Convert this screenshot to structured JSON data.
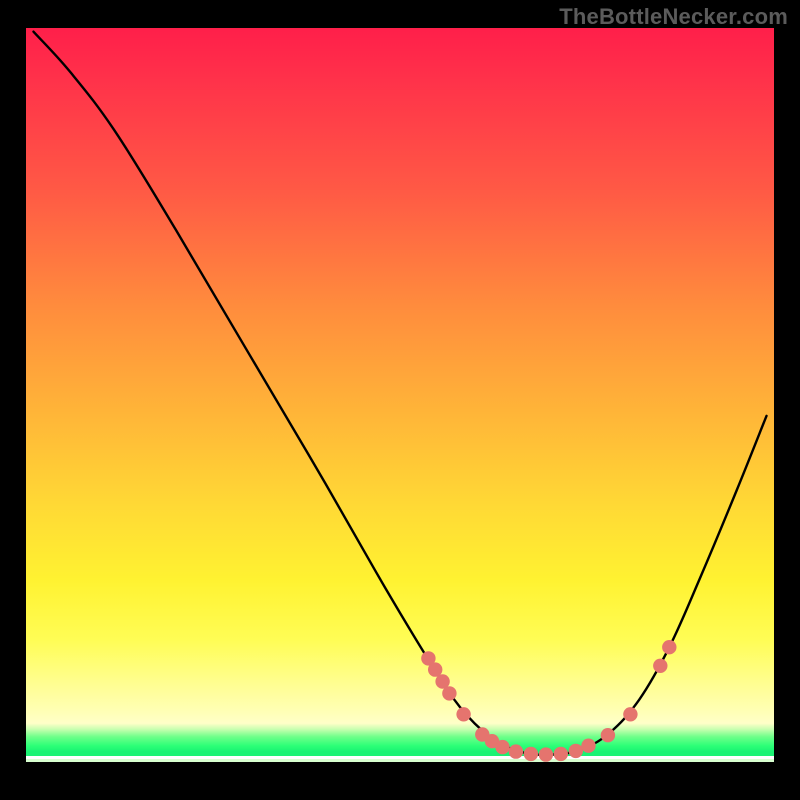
{
  "watermark": "TheBottleNecker.com",
  "colors": {
    "marker": "#e5746e",
    "curve": "#000000"
  },
  "chart_data": {
    "type": "line",
    "title": "",
    "xlabel": "",
    "ylabel": "",
    "xlim": [
      0,
      100
    ],
    "ylim": [
      0,
      100
    ],
    "curve": [
      {
        "x": 1.0,
        "y": 99.5
      },
      {
        "x": 6.0,
        "y": 94.0
      },
      {
        "x": 12.0,
        "y": 86.0
      },
      {
        "x": 20.0,
        "y": 73.0
      },
      {
        "x": 30.0,
        "y": 56.0
      },
      {
        "x": 40.0,
        "y": 39.0
      },
      {
        "x": 48.0,
        "y": 25.0
      },
      {
        "x": 54.0,
        "y": 15.0
      },
      {
        "x": 58.0,
        "y": 9.0
      },
      {
        "x": 62.0,
        "y": 5.0
      },
      {
        "x": 66.0,
        "y": 3.0
      },
      {
        "x": 70.0,
        "y": 2.6
      },
      {
        "x": 74.0,
        "y": 3.2
      },
      {
        "x": 78.0,
        "y": 5.5
      },
      {
        "x": 82.0,
        "y": 10.0
      },
      {
        "x": 86.0,
        "y": 17.0
      },
      {
        "x": 90.0,
        "y": 26.0
      },
      {
        "x": 95.0,
        "y": 38.0
      },
      {
        "x": 99.0,
        "y": 48.0
      }
    ],
    "markers": [
      {
        "x": 53.8,
        "y": 15.5
      },
      {
        "x": 54.7,
        "y": 14.0
      },
      {
        "x": 55.7,
        "y": 12.4
      },
      {
        "x": 56.6,
        "y": 10.8
      },
      {
        "x": 58.5,
        "y": 8.0
      },
      {
        "x": 61.0,
        "y": 5.3
      },
      {
        "x": 62.3,
        "y": 4.4
      },
      {
        "x": 63.7,
        "y": 3.6
      },
      {
        "x": 65.5,
        "y": 3.0
      },
      {
        "x": 67.5,
        "y": 2.7
      },
      {
        "x": 69.5,
        "y": 2.6
      },
      {
        "x": 71.5,
        "y": 2.7
      },
      {
        "x": 73.5,
        "y": 3.1
      },
      {
        "x": 75.2,
        "y": 3.8
      },
      {
        "x": 77.8,
        "y": 5.2
      },
      {
        "x": 80.8,
        "y": 8.0
      },
      {
        "x": 84.8,
        "y": 14.5
      },
      {
        "x": 86.0,
        "y": 17.0
      }
    ]
  }
}
